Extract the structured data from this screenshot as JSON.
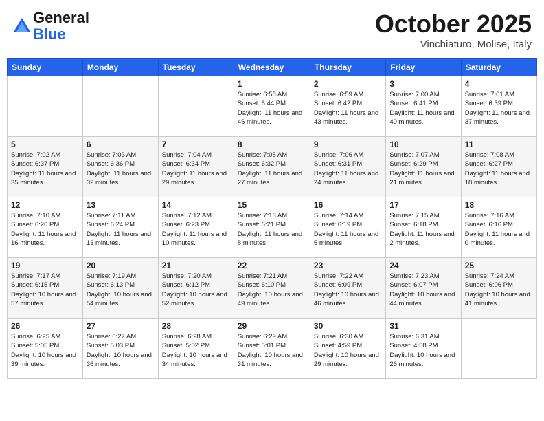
{
  "header": {
    "logo_general": "General",
    "logo_blue": "Blue",
    "month": "October 2025",
    "location": "Vinchiaturo, Molise, Italy"
  },
  "days_of_week": [
    "Sunday",
    "Monday",
    "Tuesday",
    "Wednesday",
    "Thursday",
    "Friday",
    "Saturday"
  ],
  "weeks": [
    [
      {
        "day": "",
        "data": ""
      },
      {
        "day": "",
        "data": ""
      },
      {
        "day": "",
        "data": ""
      },
      {
        "day": "1",
        "data": "Sunrise: 6:58 AM\nSunset: 6:44 PM\nDaylight: 11 hours and 46 minutes."
      },
      {
        "day": "2",
        "data": "Sunrise: 6:59 AM\nSunset: 6:42 PM\nDaylight: 11 hours and 43 minutes."
      },
      {
        "day": "3",
        "data": "Sunrise: 7:00 AM\nSunset: 6:41 PM\nDaylight: 11 hours and 40 minutes."
      },
      {
        "day": "4",
        "data": "Sunrise: 7:01 AM\nSunset: 6:39 PM\nDaylight: 11 hours and 37 minutes."
      }
    ],
    [
      {
        "day": "5",
        "data": "Sunrise: 7:02 AM\nSunset: 6:37 PM\nDaylight: 11 hours and 35 minutes."
      },
      {
        "day": "6",
        "data": "Sunrise: 7:03 AM\nSunset: 6:36 PM\nDaylight: 11 hours and 32 minutes."
      },
      {
        "day": "7",
        "data": "Sunrise: 7:04 AM\nSunset: 6:34 PM\nDaylight: 11 hours and 29 minutes."
      },
      {
        "day": "8",
        "data": "Sunrise: 7:05 AM\nSunset: 6:32 PM\nDaylight: 11 hours and 27 minutes."
      },
      {
        "day": "9",
        "data": "Sunrise: 7:06 AM\nSunset: 6:31 PM\nDaylight: 11 hours and 24 minutes."
      },
      {
        "day": "10",
        "data": "Sunrise: 7:07 AM\nSunset: 6:29 PM\nDaylight: 11 hours and 21 minutes."
      },
      {
        "day": "11",
        "data": "Sunrise: 7:08 AM\nSunset: 6:27 PM\nDaylight: 11 hours and 18 minutes."
      }
    ],
    [
      {
        "day": "12",
        "data": "Sunrise: 7:10 AM\nSunset: 6:26 PM\nDaylight: 11 hours and 16 minutes."
      },
      {
        "day": "13",
        "data": "Sunrise: 7:11 AM\nSunset: 6:24 PM\nDaylight: 11 hours and 13 minutes."
      },
      {
        "day": "14",
        "data": "Sunrise: 7:12 AM\nSunset: 6:23 PM\nDaylight: 11 hours and 10 minutes."
      },
      {
        "day": "15",
        "data": "Sunrise: 7:13 AM\nSunset: 6:21 PM\nDaylight: 11 hours and 8 minutes."
      },
      {
        "day": "16",
        "data": "Sunrise: 7:14 AM\nSunset: 6:19 PM\nDaylight: 11 hours and 5 minutes."
      },
      {
        "day": "17",
        "data": "Sunrise: 7:15 AM\nSunset: 6:18 PM\nDaylight: 11 hours and 2 minutes."
      },
      {
        "day": "18",
        "data": "Sunrise: 7:16 AM\nSunset: 6:16 PM\nDaylight: 11 hours and 0 minutes."
      }
    ],
    [
      {
        "day": "19",
        "data": "Sunrise: 7:17 AM\nSunset: 6:15 PM\nDaylight: 10 hours and 57 minutes."
      },
      {
        "day": "20",
        "data": "Sunrise: 7:19 AM\nSunset: 6:13 PM\nDaylight: 10 hours and 54 minutes."
      },
      {
        "day": "21",
        "data": "Sunrise: 7:20 AM\nSunset: 6:12 PM\nDaylight: 10 hours and 52 minutes."
      },
      {
        "day": "22",
        "data": "Sunrise: 7:21 AM\nSunset: 6:10 PM\nDaylight: 10 hours and 49 minutes."
      },
      {
        "day": "23",
        "data": "Sunrise: 7:22 AM\nSunset: 6:09 PM\nDaylight: 10 hours and 46 minutes."
      },
      {
        "day": "24",
        "data": "Sunrise: 7:23 AM\nSunset: 6:07 PM\nDaylight: 10 hours and 44 minutes."
      },
      {
        "day": "25",
        "data": "Sunrise: 7:24 AM\nSunset: 6:06 PM\nDaylight: 10 hours and 41 minutes."
      }
    ],
    [
      {
        "day": "26",
        "data": "Sunrise: 6:25 AM\nSunset: 5:05 PM\nDaylight: 10 hours and 39 minutes."
      },
      {
        "day": "27",
        "data": "Sunrise: 6:27 AM\nSunset: 5:03 PM\nDaylight: 10 hours and 36 minutes."
      },
      {
        "day": "28",
        "data": "Sunrise: 6:28 AM\nSunset: 5:02 PM\nDaylight: 10 hours and 34 minutes."
      },
      {
        "day": "29",
        "data": "Sunrise: 6:29 AM\nSunset: 5:01 PM\nDaylight: 10 hours and 31 minutes."
      },
      {
        "day": "30",
        "data": "Sunrise: 6:30 AM\nSunset: 4:59 PM\nDaylight: 10 hours and 29 minutes."
      },
      {
        "day": "31",
        "data": "Sunrise: 6:31 AM\nSunset: 4:58 PM\nDaylight: 10 hours and 26 minutes."
      },
      {
        "day": "",
        "data": ""
      }
    ]
  ]
}
